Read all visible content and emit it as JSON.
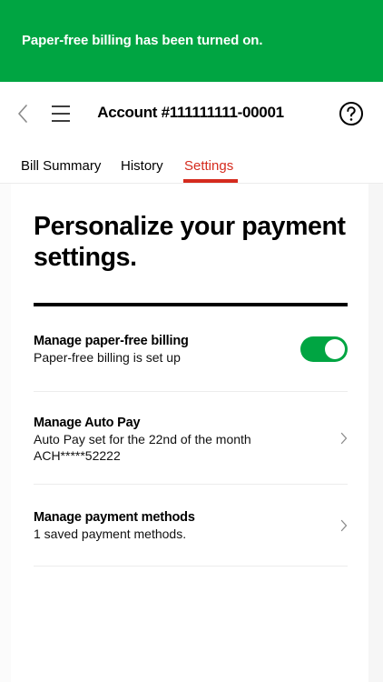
{
  "banner": {
    "message": "Paper-free billing has been turned on.",
    "color": "#00a542"
  },
  "header": {
    "title": "Account #111111111-00001",
    "back_icon": "chevron-left-icon",
    "menu_icon": "hamburger-menu-icon",
    "help_icon": "question-circle-icon"
  },
  "tabs": [
    {
      "label": "Bill Summary",
      "active": false
    },
    {
      "label": "History",
      "active": false
    },
    {
      "label": "Settings",
      "active": true
    }
  ],
  "accent_color": "#d52b1e",
  "main": {
    "heading": "Personalize your payment settings.",
    "rows": [
      {
        "title": "Manage paper-free billing",
        "lines": [
          "Paper-free billing is set up"
        ],
        "control": "toggle",
        "toggle_on": true
      },
      {
        "title": "Manage Auto Pay",
        "lines": [
          "Auto Pay set for the 22nd of the month",
          "ACH*****52222"
        ],
        "control": "chevron"
      },
      {
        "title": "Manage payment methods",
        "lines": [
          "1 saved payment methods."
        ],
        "control": "chevron"
      }
    ]
  }
}
